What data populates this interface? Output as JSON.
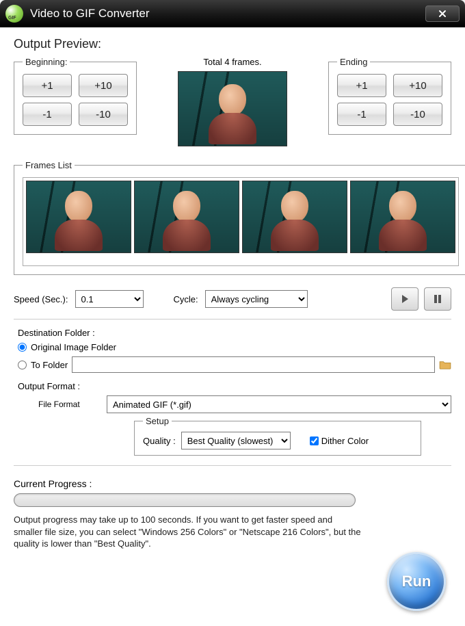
{
  "window": {
    "title": "Video to GIF Converter"
  },
  "preview": {
    "heading": "Output Preview:",
    "beginning_legend": "Beginning:",
    "ending_legend": "Ending",
    "btn_plus1": "+1",
    "btn_plus10": "+10",
    "btn_minus1": "-1",
    "btn_minus10": "-10",
    "total_frames": "Total 4 frames."
  },
  "frames": {
    "legend": "Frames List",
    "count": 4
  },
  "playback": {
    "speed_label": "Speed (Sec.):",
    "speed_value": "0.1",
    "cycle_label": "Cycle:",
    "cycle_value": "Always cycling"
  },
  "destination": {
    "heading": "Destination Folder :",
    "opt_original": "Original Image Folder",
    "opt_tofolder": "To Folder",
    "folder_path": ""
  },
  "format": {
    "heading": "Output Format :",
    "file_format_label": "File Format",
    "file_format_value": "Animated GIF (*.gif)",
    "setup_legend": "Setup",
    "quality_label": "Quality :",
    "quality_value": "Best Quality (slowest)",
    "dither_label": "Dither Color",
    "dither_checked": true
  },
  "progress": {
    "label": "Current Progress :",
    "hint": "Output progress may take up to 100 seconds. If you want to get faster speed and smaller file size, you can select \"Windows 256 Colors\" or \"Netscape 216 Colors\", but the quality is lower than \"Best Quality\"."
  },
  "run_label": "Run"
}
